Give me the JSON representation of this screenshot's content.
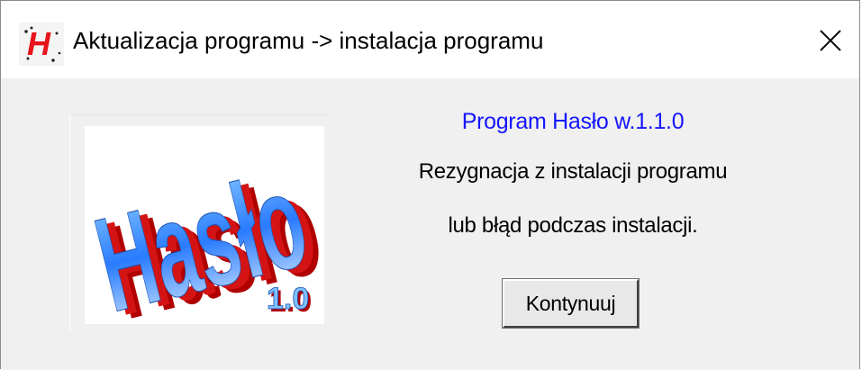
{
  "window": {
    "title": "Aktualizacja programu -> instalacja programu",
    "icon": "h-app-icon",
    "close_icon": "close-icon"
  },
  "logo": {
    "word": "Hasło",
    "version": "1.0"
  },
  "content": {
    "program_name": "Program Hasło w.1.1.0",
    "message_line1": "Rezygnacja z instalacji programu",
    "message_line2": "lub błąd podczas instalacji."
  },
  "buttons": {
    "continue_label": "Kontynuuj"
  },
  "colors": {
    "program_name": "#1515ff",
    "icon_red": "#e8141c",
    "logo_red": "#b00000",
    "logo_blue": "#2a7bff"
  }
}
